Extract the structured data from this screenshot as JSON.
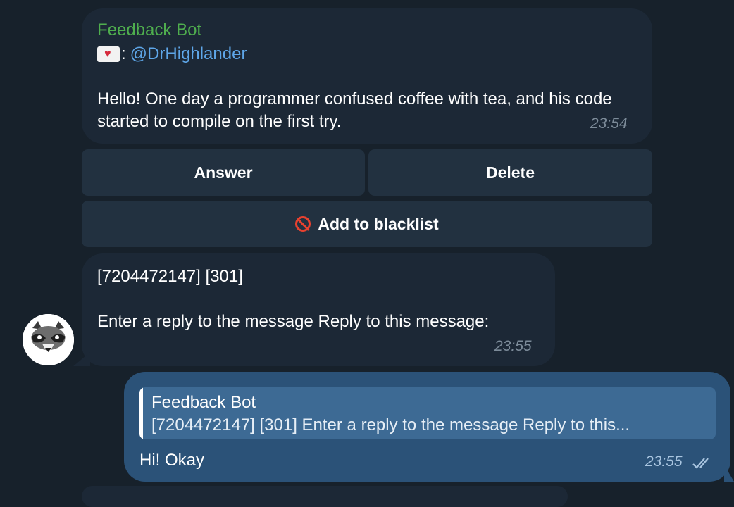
{
  "message1": {
    "sender": "Feedback Bot",
    "from_label": ":",
    "handle": "@DrHighlander",
    "text": "Hello! One day a programmer confused coffee with tea, and his code started to compile on the first try.",
    "time": "23:54"
  },
  "keyboard": {
    "answer_label": "Answer",
    "delete_label": "Delete",
    "blacklist_label": "Add to blacklist"
  },
  "message2": {
    "line1": "[7204472147] [301]",
    "line2": "Enter a reply to the message Reply to this message:",
    "time": "23:55"
  },
  "message3": {
    "quote_title": "Feedback Bot",
    "quote_text": "[7204472147] [301]   Enter a reply to the message Reply to this...",
    "text": "Hi! Okay",
    "time": "23:55"
  },
  "colors": {
    "background": "#17212b",
    "incoming_bubble": "#1c2836",
    "outgoing_bubble": "#2b5278",
    "sender_name": "#4fae4e",
    "link": "#5ea6e8"
  },
  "icons": [
    "envelope-heart-icon",
    "no-entry-icon",
    "raccoon-avatar",
    "double-check-icon"
  ]
}
